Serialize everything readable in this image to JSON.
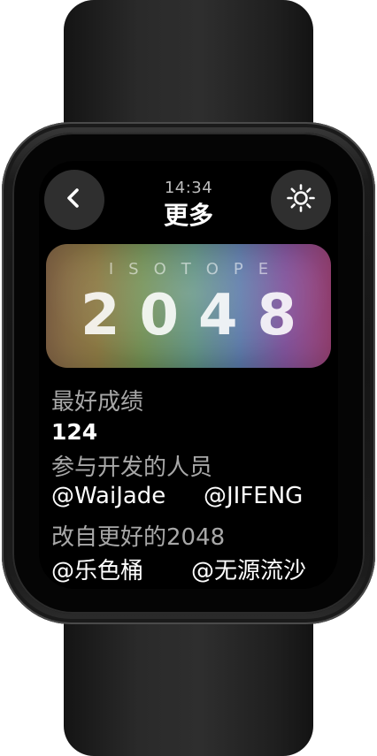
{
  "status": {
    "time": "14:34"
  },
  "header": {
    "title": "更多",
    "back_icon": "chevron-left-icon",
    "settings_icon": "sun-icon"
  },
  "banner": {
    "label": "ISOTOPE",
    "number": "2048"
  },
  "best_score": {
    "label": "最好成绩",
    "value": "124"
  },
  "developers": {
    "label": "参与开发的人员",
    "names": [
      "@WaiJade",
      "@JIFENG"
    ]
  },
  "based_on": {
    "label": "改自更好的2048",
    "names": [
      "@乐色桶",
      "@无源流沙"
    ]
  },
  "colors": {
    "screen_bg": "#000000",
    "button_bg": "#2f2f2f",
    "label_text": "#a8a8a8",
    "value_text": "#ffffff"
  }
}
